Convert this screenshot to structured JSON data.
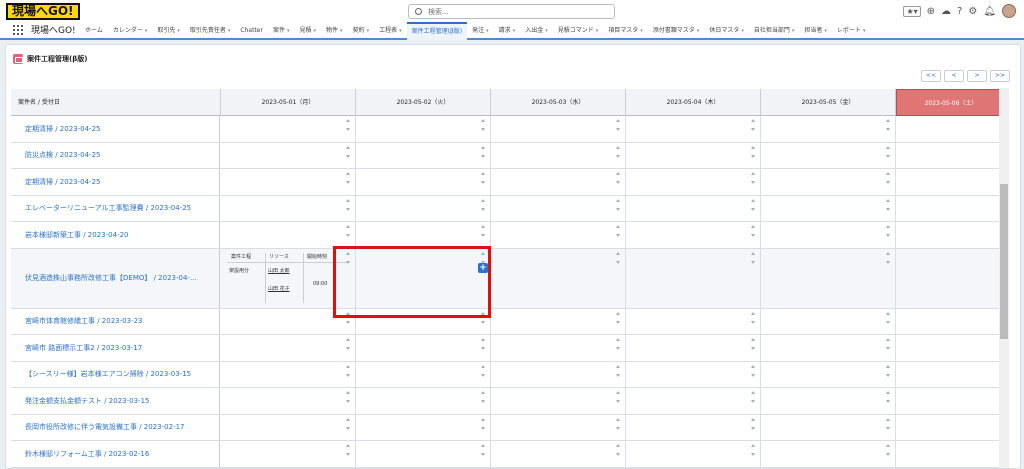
{
  "header": {
    "logo": "現場へGO!",
    "search_placeholder": "検索...",
    "favorites_icon": "star-icon"
  },
  "nav": {
    "app_name": "現場へGO!",
    "tabs": [
      {
        "label": "ホーム",
        "dropdown": false
      },
      {
        "label": "カレンダー",
        "dropdown": true
      },
      {
        "label": "取引先",
        "dropdown": true
      },
      {
        "label": "取引先責任者",
        "dropdown": true
      },
      {
        "label": "Chatter",
        "dropdown": false
      },
      {
        "label": "案件",
        "dropdown": true
      },
      {
        "label": "見積",
        "dropdown": true
      },
      {
        "label": "物件",
        "dropdown": true
      },
      {
        "label": "契約",
        "dropdown": true
      },
      {
        "label": "工程表",
        "dropdown": true
      },
      {
        "label": "案件工程管理(β版)",
        "dropdown": false,
        "active": true
      },
      {
        "label": "発注",
        "dropdown": true
      },
      {
        "label": "請求",
        "dropdown": true
      },
      {
        "label": "入出金",
        "dropdown": true
      },
      {
        "label": "見積コマンド",
        "dropdown": true
      },
      {
        "label": "項目マスタ",
        "dropdown": true
      },
      {
        "label": "添付書類マスタ",
        "dropdown": true
      },
      {
        "label": "休日マスタ",
        "dropdown": true
      },
      {
        "label": "自社担当部門",
        "dropdown": true
      },
      {
        "label": "担当者",
        "dropdown": true
      },
      {
        "label": "レポート",
        "dropdown": true
      }
    ]
  },
  "page": {
    "title": "案件工程管理(β版)",
    "pager": [
      "<<",
      "<",
      ">",
      ">>"
    ]
  },
  "table": {
    "first_header": "案件名 / 受付日",
    "dates": [
      "2023-05-01（月）",
      "2023-05-02（火）",
      "2023-05-03（水）",
      "2023-05-04（木）",
      "2023-05-05（金）",
      "2023-05-06（土）"
    ],
    "rows": [
      {
        "name": "定期清掃 / 2023-04-25"
      },
      {
        "name": "防災点検 / 2023-04-25"
      },
      {
        "name": "定期清掃 / 2023-04-25"
      },
      {
        "name": "エレベーターリニューアル工事監理費 / 2023-04-25"
      },
      {
        "name": "岩本様邸新築工事 / 2023-04-20"
      },
      {
        "name": "伏見酒造株山事務所改修工事【DEMO】 / 2023-04-..."
      },
      {
        "name": "宮崎市体育館修繕工事 / 2023-03-23"
      },
      {
        "name": "宮崎市 路面標示工事2 / 2023-03-17"
      },
      {
        "name": "【シースリー様】岩本様エアコン掃除 / 2023-03-15"
      },
      {
        "name": "発注金額支払金額テスト / 2023-03-15"
      },
      {
        "name": "長岡市役所改修に伴う電気設備工事 / 2023-02-17"
      },
      {
        "name": "鈴木様邸リフォーム工事 / 2023-02-16"
      }
    ],
    "schedule": {
      "headers": [
        "案件工程",
        "リソース",
        "開始時刻"
      ],
      "process": "架設用分",
      "resources": [
        "山田 太郎",
        "山田 花子"
      ],
      "start_time": "09:00"
    },
    "add_button": "+"
  }
}
